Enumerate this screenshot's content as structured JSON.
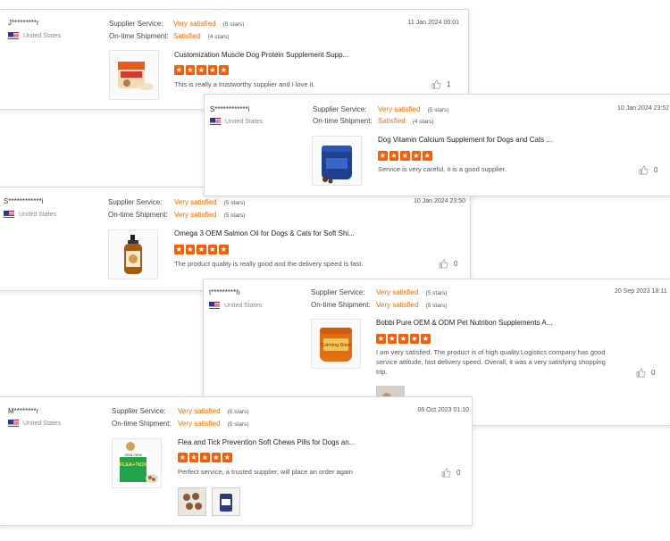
{
  "labels": {
    "supplier_service": "Supplier Service:",
    "ontime_shipment": "On-time Shipment:"
  },
  "reviews": [
    {
      "user": "J*********r",
      "country": "United States",
      "date": "11 Jan 2024 00:01",
      "supplier_service": "Very satisfied",
      "supplier_stars": "(5 stars)",
      "shipment": "Satisfied",
      "shipment_stars": "(4 stars)",
      "product": "Customization Muscle Dog Protein Supplement Supp...",
      "rating": 5,
      "text": "This is really a trustworthy supplier and I love it.",
      "likes": "1"
    },
    {
      "user": "S************i",
      "country": "United States",
      "date": "10 Jan 2024 23:52",
      "supplier_service": "Very satisfied",
      "supplier_stars": "(5 stars)",
      "shipment": "Satisfied",
      "shipment_stars": "(4 stars)",
      "product": "Dog Vitamin Calcium Supplement for Dogs and Cats ...",
      "rating": 5,
      "text": "Service is very careful, it is a good supplier.",
      "likes": "0"
    },
    {
      "user": "S************i",
      "country": "United States",
      "date": "10 Jan 2024 23:50",
      "supplier_service": "Very satisfied",
      "supplier_stars": "(5 stars)",
      "shipment": "Very satisfied",
      "shipment_stars": "(5 stars)",
      "product": "Omega 3 OEM Salmon Oil for Dogs & Cats for Soft Shi...",
      "rating": 5,
      "text": "The product quality is really good and the delivery speed is fast.",
      "likes": "0"
    },
    {
      "user": "t*********h",
      "country": "United States",
      "date": "20 Sep 2023 18:11",
      "supplier_service": "Very satisfied",
      "supplier_stars": "(5 stars)",
      "shipment": "Very satisfied",
      "shipment_stars": "(5 stars)",
      "product": "Bobbi Pure OEM & ODM Pet Nutrition Supplements A...",
      "rating": 5,
      "text": "I am very satisfied. The product is of high quality.Logistics company has good service attitude, fast delivery speed. Overall, it was a very satisfying shopping trip.",
      "likes": "0"
    },
    {
      "user": "M********r",
      "country": "United States",
      "date": "06 Oct 2023 01:10",
      "supplier_service": "Very satisfied",
      "supplier_stars": "(5 stars)",
      "shipment": "Very satisfied",
      "shipment_stars": "(5 stars)",
      "product": "Flea and Tick Prevention Soft Chews Pills for Dogs an...",
      "rating": 5,
      "text": "Perfect service, a trusted supplier, will place an order again",
      "likes": "0"
    }
  ],
  "product_image_texts": {
    "bobbi": "Calming Bites",
    "flea_brand": "OEM ODM",
    "flea_title": "FLEA+TICK"
  },
  "icons": {
    "like": "thumbs-up-icon",
    "flag": "us-flag-icon",
    "star": "star-icon"
  },
  "colors": {
    "accent": "#ff6a00",
    "star": "#ff5a00"
  }
}
